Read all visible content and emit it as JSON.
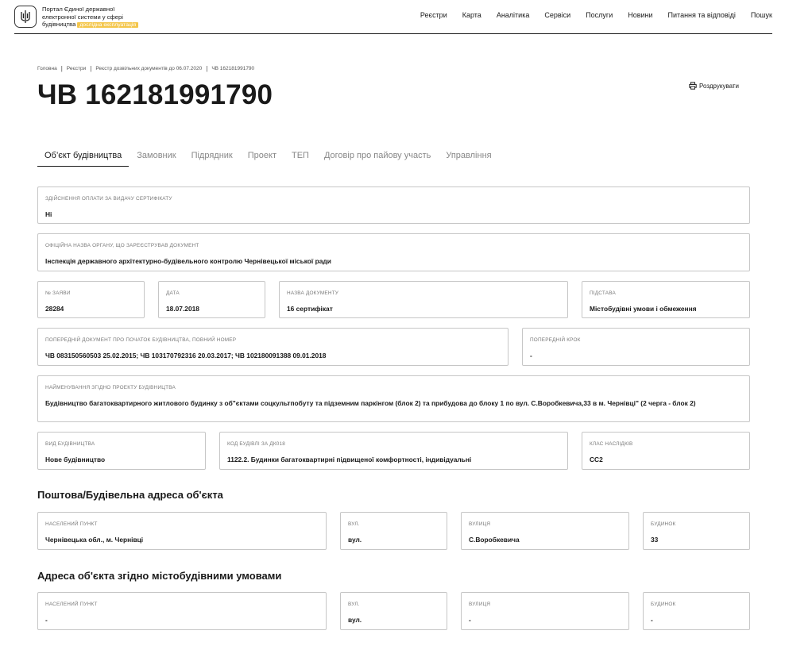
{
  "header": {
    "brand_line1": "Портал Єдиної державної",
    "brand_line2": "електронної системи у сфері",
    "brand_line3": "будівництва",
    "badge": "дослідна експлуатація",
    "nav": [
      "Реєстри",
      "Карта",
      "Аналітика",
      "Сервіси",
      "Послуги",
      "Новини",
      "Питання та відповіді",
      "Пошук"
    ]
  },
  "breadcrumb": [
    "Головна",
    "Реєстри",
    "Реєстр дозвільних документів до 06.07.2020",
    "ЧВ 162181991790"
  ],
  "page_title": "ЧВ 162181991790",
  "print_label": "Роздрукувати",
  "tabs": [
    "Об’єкт будівництва",
    "Замовник",
    "Підрядник",
    "Проект",
    "ТЕП",
    "Договір про пайову участь",
    "Управління"
  ],
  "fields": {
    "payment": {
      "label": "Здійснення оплати за видачу сертифікату",
      "value": "Ні"
    },
    "authority": {
      "label": "Офіційна назва органу, що зареєстрував документ",
      "value": "Інспекція державного архітектурно-будівельного контролю Чернівецької міської ради"
    },
    "app_no": {
      "label": "№ заяви",
      "value": "28284"
    },
    "date": {
      "label": "Дата",
      "value": "18.07.2018"
    },
    "doc_name": {
      "label": "Назва документу",
      "value": "16 сертифікат"
    },
    "basis": {
      "label": "Підстава",
      "value": "Містобудівні умови і обмеження"
    },
    "prev_doc": {
      "label": "Попередній документ про початок будівництва, повний номер",
      "value": "ЧВ 083150560503 25.02.2015; ЧВ 103170792316 20.03.2017; ЧВ 102180091388 09.01.2018"
    },
    "prev_step": {
      "label": "Попередній крок",
      "value": "-"
    },
    "project_name": {
      "label": "Найменування згідно проекту будівництва",
      "value": "Будівництво багатоквартирного житлового будинку з об\"єктами соцкультпобуту та підземним паркінгом (блок 2) та прибудова до блоку 1 по вул. С.Воробкевича,33 в м. Чернівці\" (2 черга - блок 2)"
    },
    "build_type": {
      "label": "Вид будівництва",
      "value": "Нове будівництво"
    },
    "build_code": {
      "label": "Код будівлі за ДК018",
      "value": "1122.2. Будинки багатоквартирні підвищеної комфортності, індивідуальні"
    },
    "cc_class": {
      "label": "Клас наслідків",
      "value": "СС2"
    }
  },
  "postal_section": {
    "title": "Поштова/Будівельна адреса об'єкта",
    "locality": {
      "label": "Населений пункт",
      "value": "Чернівецька обл., м. Чернівці"
    },
    "street_type": {
      "label": "Вул.",
      "value": "вул."
    },
    "street": {
      "label": "Вулиця",
      "value": "С.Воробкевича"
    },
    "building": {
      "label": "Будинок",
      "value": "33"
    }
  },
  "urban_section": {
    "title": "Адреса об'єкта згідно містобудівними умовами",
    "locality": {
      "label": "Населений пункт",
      "value": "-"
    },
    "street_type": {
      "label": "Вул.",
      "value": "вул."
    },
    "street": {
      "label": "Вулиця",
      "value": "-"
    },
    "building": {
      "label": "Будинок",
      "value": "-"
    }
  }
}
